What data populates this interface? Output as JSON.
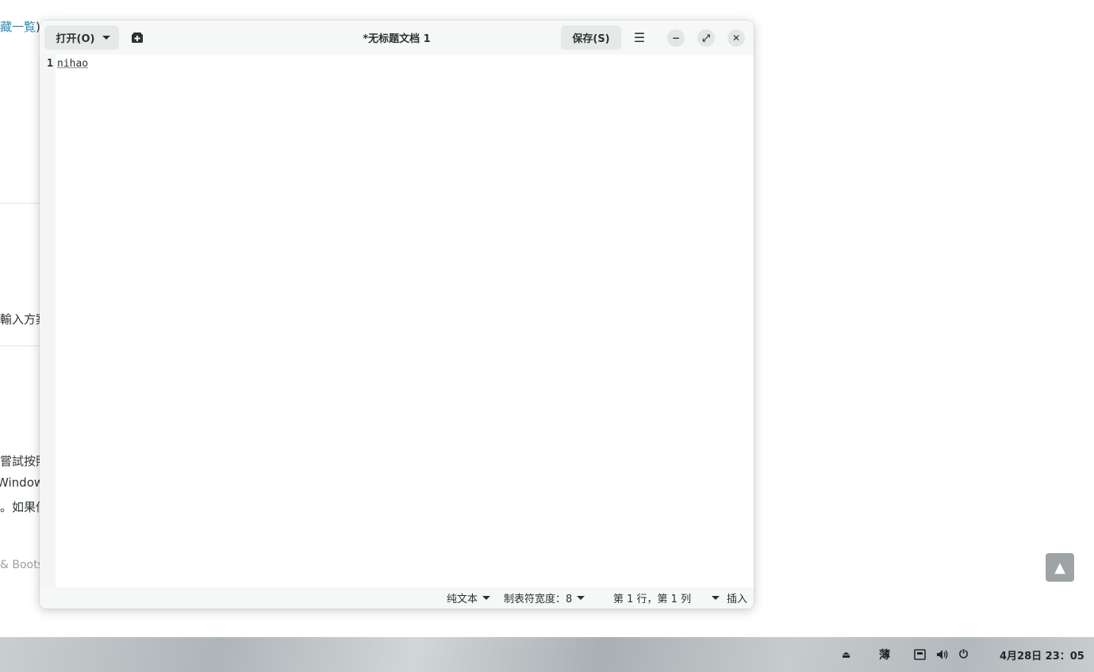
{
  "background_page": {
    "fragments": [
      {
        "text": "藏一覧",
        "style": "link"
      },
      {
        "text": ")",
        "style": "normal"
      },
      {
        "text": "輸入方案",
        "style": "normal"
      },
      {
        "text": "嘗試按照",
        "style": "normal"
      },
      {
        "text": "Windows",
        "style": "normal"
      },
      {
        "text": "。如果你",
        "style": "normal"
      },
      {
        "text": "& Bootswatch",
        "style": "gray"
      }
    ],
    "scroll_top_icon": "▲"
  },
  "editor": {
    "title": "*无标题文档 1",
    "open_label": "打开(O)",
    "save_label": "保存(S)",
    "new_tab_icon": "new-tab-icon",
    "menu_icon": "☰",
    "minimize_icon": "−",
    "maximize_icon": "⤢",
    "close_icon": "✕",
    "line_numbers": [
      "1"
    ],
    "lines": [
      "nihao"
    ],
    "statusbar": {
      "language": "纯文本",
      "tab_width": "制表符宽度：8",
      "position": "第 1 行，第 1 列",
      "mode": "插入"
    }
  },
  "taskbar": {
    "eject_icon": "⏏",
    "input_method": "薄",
    "network_icon": "network-icon",
    "volume_icon": "volume-icon",
    "power_icon": "⏻",
    "datetime": "4月28日 23：05"
  }
}
